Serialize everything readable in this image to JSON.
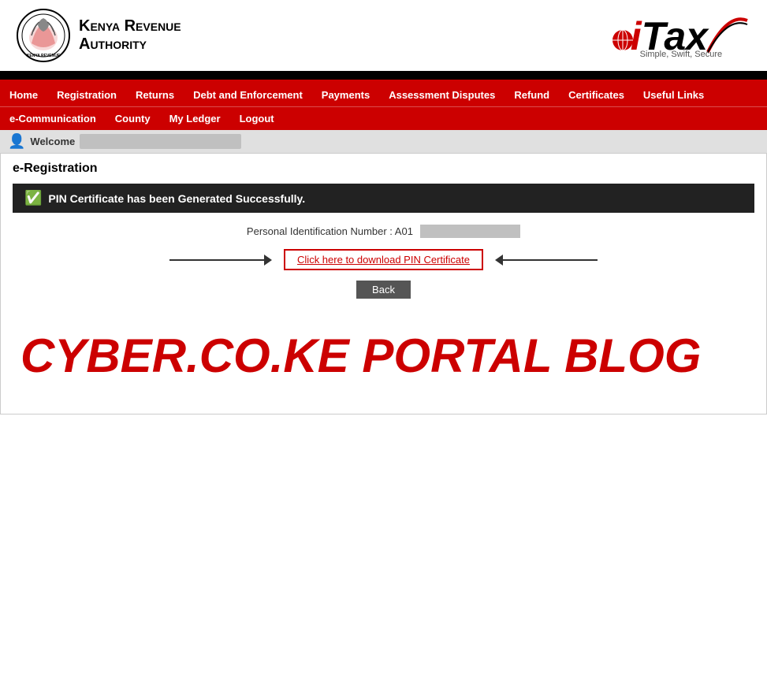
{
  "header": {
    "kra_name_line1": "Kenya Revenue",
    "kra_name_line2": "Authority",
    "itax_i": "i",
    "itax_tax": "Tax",
    "itax_tagline": "Simple, Swift, Secure"
  },
  "nav": {
    "row1": [
      {
        "label": "Home",
        "id": "home"
      },
      {
        "label": "Registration",
        "id": "registration"
      },
      {
        "label": "Returns",
        "id": "returns"
      },
      {
        "label": "Debt and Enforcement",
        "id": "debt"
      },
      {
        "label": "Payments",
        "id": "payments"
      },
      {
        "label": "Assessment Disputes",
        "id": "assessment"
      },
      {
        "label": "Refund",
        "id": "refund"
      },
      {
        "label": "Certificates",
        "id": "certificates"
      },
      {
        "label": "Useful Links",
        "id": "useful-links"
      }
    ],
    "row2": [
      {
        "label": "e-Communication",
        "id": "ecommunication"
      },
      {
        "label": "County",
        "id": "county"
      },
      {
        "label": "My Ledger",
        "id": "my-ledger"
      },
      {
        "label": "Logout",
        "id": "logout"
      }
    ]
  },
  "welcome": {
    "label": "Welcome",
    "user_placeholder": ""
  },
  "page": {
    "title_bold": "e-Registration",
    "title_normal": ""
  },
  "success": {
    "message": "PIN Certificate has been Generated Successfully."
  },
  "pin": {
    "label": "Personal Identification Number : A01",
    "value_placeholder": ""
  },
  "download": {
    "button_label": "Click here to download PIN Certificate"
  },
  "back": {
    "button_label": "Back"
  },
  "watermark": {
    "text": "CYBER.CO.KE PORTAL BLOG"
  }
}
